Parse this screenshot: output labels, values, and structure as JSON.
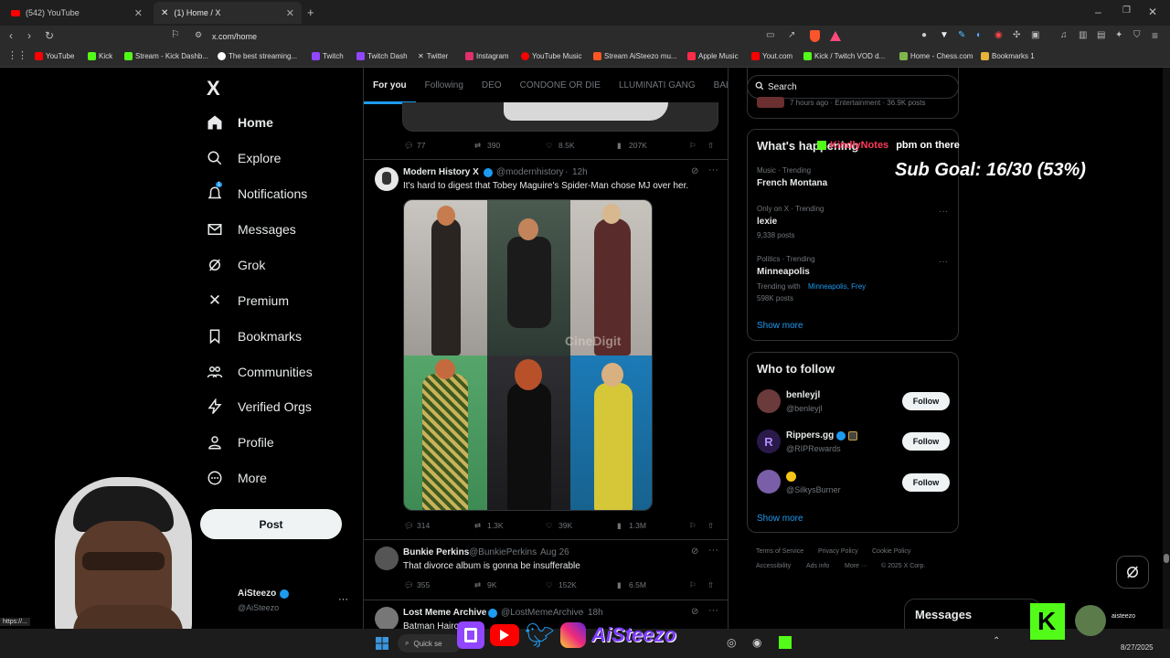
{
  "browser": {
    "tabs": [
      {
        "label": "(542) YouTube",
        "active": false
      },
      {
        "label": "(1) Home / X",
        "active": true
      }
    ],
    "new_tab": "+",
    "address": "x.com/home",
    "bookmarks": [
      {
        "label": "YouTube",
        "color": "#ff0000"
      },
      {
        "label": "Kick",
        "color": "#53fc18"
      },
      {
        "label": "Stream - Kick Dashb...",
        "color": "#53fc18"
      },
      {
        "label": "The best streaming...",
        "color": "#ffffff"
      },
      {
        "label": "Twitch",
        "color": "#9146ff"
      },
      {
        "label": "Twitch Dash",
        "color": "#9146ff"
      },
      {
        "label": "Twitter",
        "color": "#ffffff"
      },
      {
        "label": "Instagram",
        "color": "#e1306c"
      },
      {
        "label": "YouTube Music",
        "color": "#ff0000"
      },
      {
        "label": "Stream AiSteezo mu...",
        "color": "#ff5722"
      },
      {
        "label": "Apple Music",
        "color": "#fa2d48"
      },
      {
        "label": "Yout.com",
        "color": "#ff0000"
      },
      {
        "label": "Kick / Twitch VOD d...",
        "color": "#53fc18"
      },
      {
        "label": "Home - Chess.com",
        "color": "#81b64c"
      },
      {
        "label": "Bookmarks 1",
        "color": "#e8b339"
      }
    ]
  },
  "sidebar": {
    "logo": "X",
    "items": [
      {
        "label": "Home",
        "icon": "home-icon"
      },
      {
        "label": "Explore",
        "icon": "search-icon"
      },
      {
        "label": "Notifications",
        "icon": "bell-icon",
        "badge": "1"
      },
      {
        "label": "Messages",
        "icon": "mail-icon"
      },
      {
        "label": "Grok",
        "icon": "grok-icon"
      },
      {
        "label": "Premium",
        "icon": "x-icon"
      },
      {
        "label": "Bookmarks",
        "icon": "bookmark-icon"
      },
      {
        "label": "Communities",
        "icon": "people-icon"
      },
      {
        "label": "Verified Orgs",
        "icon": "lightning-icon"
      },
      {
        "label": "Profile",
        "icon": "person-icon"
      },
      {
        "label": "More",
        "icon": "more-circle-icon"
      }
    ],
    "post_label": "Post",
    "account_name": "AiSteezo",
    "account_handle": "@AiSteezo",
    "account_more": "···"
  },
  "feed": {
    "tabs": [
      "For you",
      "Following",
      "DEO",
      "CONDONE OR DIE",
      "LLUMINATI GANG",
      "BAL"
    ],
    "prev_actions": {
      "replies": "77",
      "reposts": "390",
      "likes": "8.5K",
      "views": "207K"
    },
    "tweets": [
      {
        "name": "Modern History X",
        "handle": "@modernhistory",
        "time": "12h",
        "text": "It's hard to digest that Tobey Maguire's Spider-Man chose MJ over her.",
        "actions": {
          "replies": "314",
          "reposts": "1.3K",
          "likes": "39K",
          "views": "1.3M"
        },
        "photo_watermark": "CineDigit"
      },
      {
        "name": "Bunkie Perkins",
        "handle": "@BunkiePerkins",
        "time": "Aug 26",
        "text": "That divorce album is gonna be insufferable",
        "actions": {
          "replies": "355",
          "reposts": "9K",
          "likes": "152K",
          "views": "6.5M"
        }
      },
      {
        "name": "Lost Meme Archive",
        "handle": "@LostMemeArchive",
        "time": "18h",
        "text": "Batman Hairc"
      }
    ]
  },
  "right": {
    "search_placeholder": "Search",
    "top_partial": "7 hours ago · Entertainment · 36.9K posts",
    "happening_title": "What's happening",
    "trends": [
      {
        "category": "Music · Trending",
        "name": "French Montana",
        "posts": ""
      },
      {
        "category": "Only on X · Trending",
        "name": "lexie",
        "posts": "9,338 posts"
      },
      {
        "category": "Politics · Trending",
        "name": "Minneapolis",
        "trending_with_label": "Trending with",
        "trending_with": "Minneapolis, Frey",
        "posts": "598K posts"
      }
    ],
    "show_more": "Show more",
    "who_to_follow_title": "Who to follow",
    "follow": [
      {
        "name": "benleyjl",
        "handle": "@benleyjl",
        "button": "Follow"
      },
      {
        "name": "Rippers.gg",
        "handle": "@RIPRewards",
        "button": "Follow"
      },
      {
        "name": "",
        "handle": "@SilkysBurner",
        "button": "Follow"
      }
    ],
    "show_more_2": "Show more",
    "footer": [
      "Terms of Service",
      "Privacy Policy",
      "Cookie Policy",
      "Accessibility",
      "Ads info",
      "More ···",
      "© 2025 X Corp."
    ],
    "messages_label": "Messages"
  },
  "overlay": {
    "alert_name": "KindlyNotes",
    "alert_text": "pbm on there",
    "sub_goal": "Sub Goal: 16/30 (53%)",
    "sub_goal_fraction": 0.53,
    "brand": "AiSteezo",
    "kick_user": "aisteezo"
  },
  "status_url": "https://...",
  "taskbar": {
    "search_placeholder": "Quick se",
    "date": "8/27/2025"
  }
}
